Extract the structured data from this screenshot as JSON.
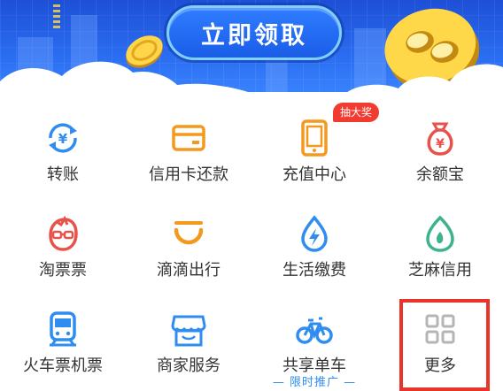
{
  "banner": {
    "claim_button": "立即领取"
  },
  "colors": {
    "banner_blue": "#2a6cf0",
    "icon_blue": "#2f8df0",
    "icon_orange": "#f39a1e",
    "icon_red": "#e8524a",
    "icon_green": "#3bb38b",
    "badge_red": "#f23b30",
    "highlight_red": "#e8352c"
  },
  "grid": {
    "items": [
      {
        "label": "转账",
        "icon": "transfer-icon"
      },
      {
        "label": "信用卡还款",
        "icon": "credit-card-icon"
      },
      {
        "label": "充值中心",
        "icon": "phone-recharge-icon"
      },
      {
        "label": "余额宝",
        "icon": "money-bag-icon"
      },
      {
        "label": "淘票票",
        "icon": "taopiaopiao-icon"
      },
      {
        "label": "滴滴出行",
        "icon": "didi-icon"
      },
      {
        "label": "生活缴费",
        "icon": "utility-bolt-icon"
      },
      {
        "label": "芝麻信用",
        "icon": "sesame-credit-icon"
      },
      {
        "label": "火车票机票",
        "icon": "train-icon"
      },
      {
        "label": "商家服务",
        "icon": "store-icon"
      },
      {
        "label": "共享单车",
        "icon": "bicycle-icon"
      },
      {
        "label": "更多",
        "icon": "more-grid-icon"
      }
    ]
  },
  "badge": {
    "text": "抽大奖"
  },
  "promo": {
    "text": "— 限时推广 —"
  }
}
